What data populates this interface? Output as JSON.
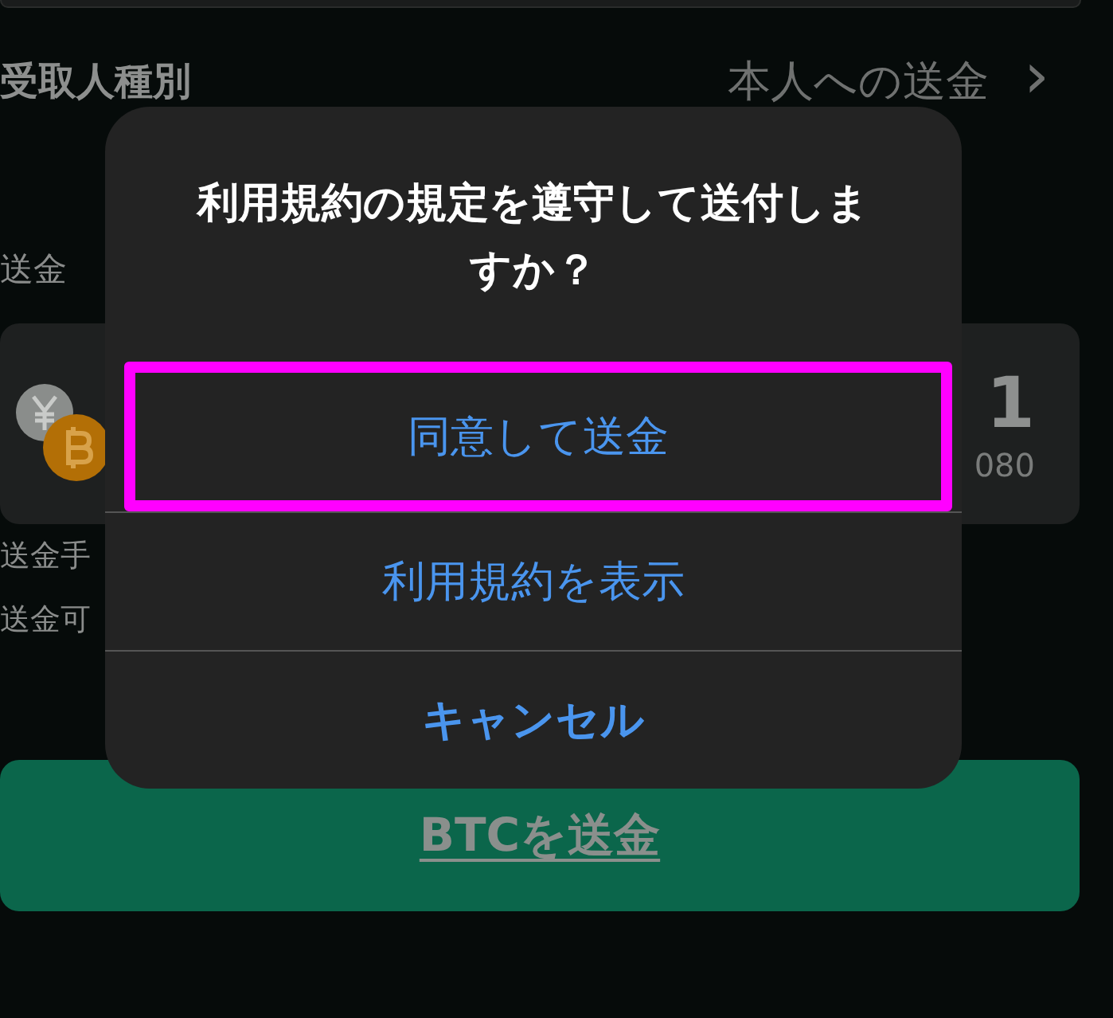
{
  "recipient_row": {
    "label": "受取人種別",
    "value": "本人への送金",
    "chevron": "›"
  },
  "amount_label": "送金",
  "amount_card": {
    "amount": "1",
    "sub_amount": "080"
  },
  "fee_label": "送金手",
  "available_label": "送金可",
  "send_button": {
    "label": "BTCを送金"
  },
  "alert": {
    "title": "利用規約の規定を遵守して送付しますか？",
    "actions": [
      {
        "label": "同意して送金",
        "kind": "default",
        "highlighted": true
      },
      {
        "label": "利用規約を表示",
        "kind": "default",
        "highlighted": false
      },
      {
        "label": "キャンセル",
        "kind": "cancel",
        "highlighted": false
      }
    ]
  }
}
